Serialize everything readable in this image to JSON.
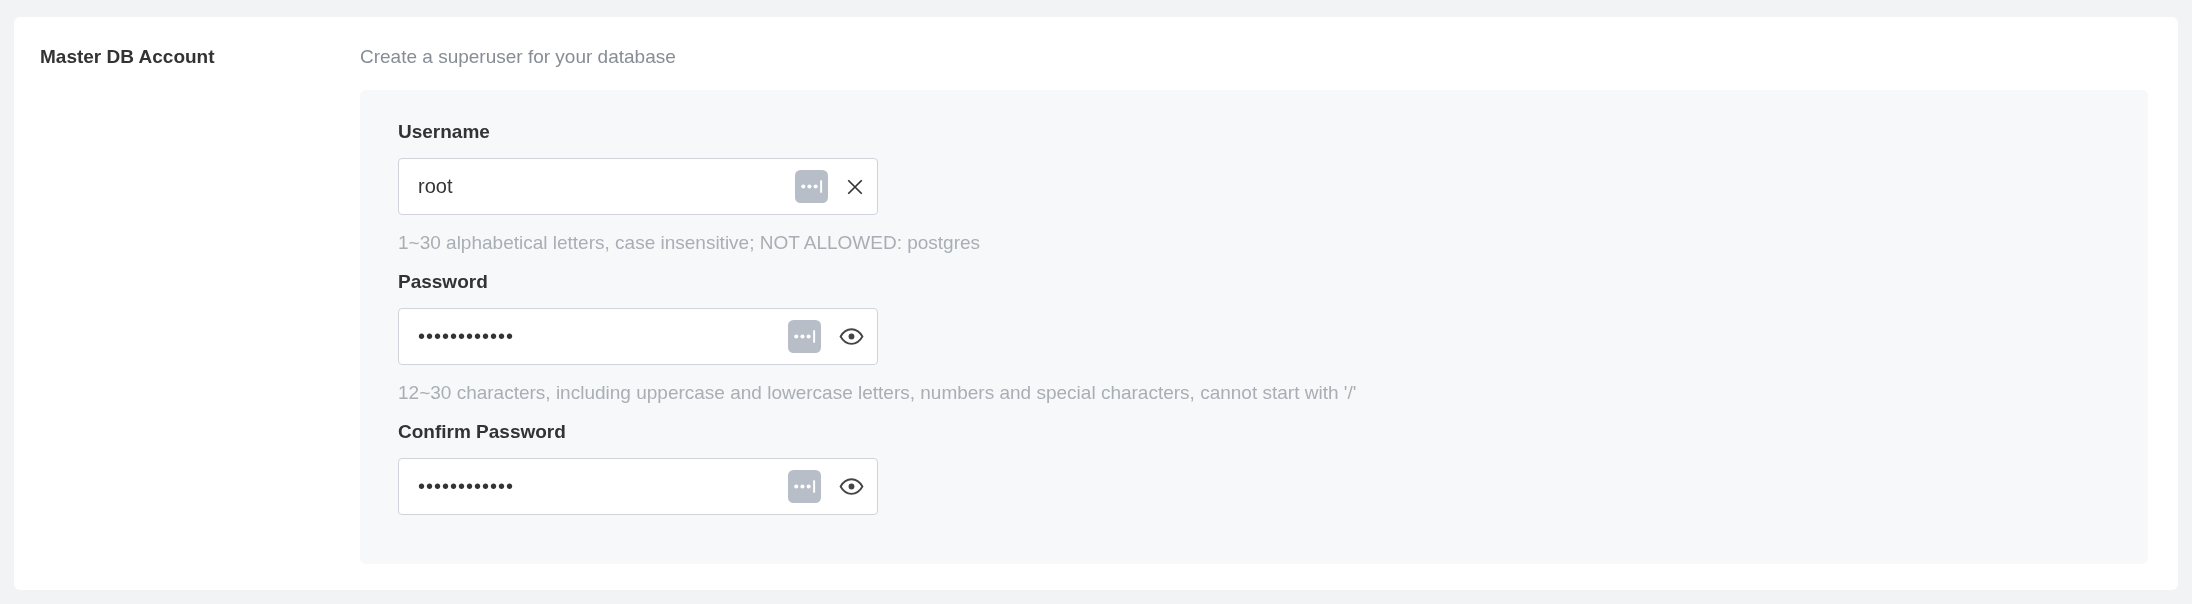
{
  "section": {
    "title": "Master DB Account",
    "description": "Create a superuser for your database"
  },
  "fields": [
    {
      "label": "Username",
      "value": "root",
      "kind": "clear",
      "hint": "1~30 alphabetical letters, case insensitive; NOT ALLOWED: postgres"
    },
    {
      "label": "Password",
      "value": "••••••••••••",
      "kind": "reveal",
      "hint": "12~30 characters, including uppercase and lowercase letters, numbers and special characters, cannot start with '/'"
    },
    {
      "label": "Confirm Password",
      "value": "••••••••••••",
      "kind": "reveal"
    }
  ]
}
